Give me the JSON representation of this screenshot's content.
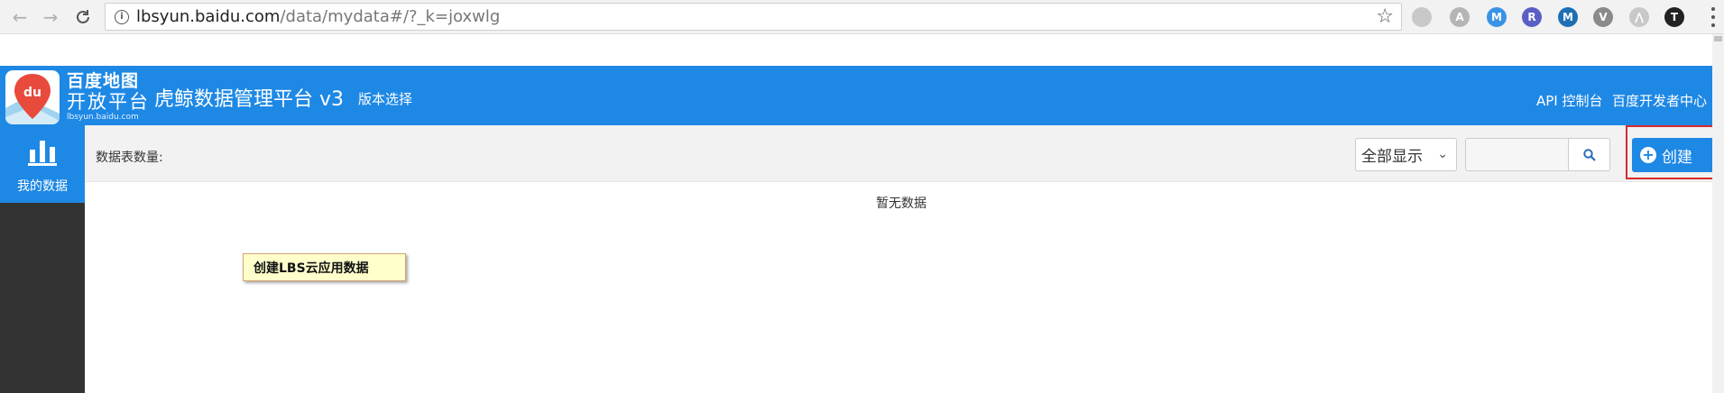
{
  "browser": {
    "url_host": "lbsyun.baidu.com",
    "url_path": "/data/mydata#/?_k=joxwlg",
    "extensions": [
      {
        "name": "extension-1",
        "letter": "",
        "color": "#c8c8c8"
      },
      {
        "name": "angular-extension",
        "letter": "A",
        "color": "#b5b5b5"
      },
      {
        "name": "m-extension",
        "letter": "M",
        "color": "#3a94e5"
      },
      {
        "name": "r-extension",
        "letter": "R",
        "color": "#5a5fc7"
      },
      {
        "name": "m-square-extension",
        "letter": "M",
        "color": "#1f6fb5"
      },
      {
        "name": "vue-extension",
        "letter": "V",
        "color": "#8a8a8a"
      },
      {
        "name": "tree-extension",
        "letter": "⋀",
        "color": "#c8c8c8"
      },
      {
        "name": "t-extension",
        "letter": "T",
        "color": "#222222"
      }
    ]
  },
  "header": {
    "logo_line1": "百度地图",
    "logo_line2": "开放平台",
    "logo_line3": "lbsyun.baidu.com",
    "logo_mark": "du",
    "title": "虎鲸数据管理平台 v3",
    "version_link": "版本选择",
    "api_console": "API 控制台",
    "dev_center": "百度开发者中心"
  },
  "sidebar": {
    "items": [
      {
        "label": "我的数据",
        "icon": "bar-chart-icon"
      }
    ]
  },
  "toolbar": {
    "count_label": "数据表数量:",
    "filter_value": "全部显示",
    "search_value": "",
    "create_label": "创建"
  },
  "main": {
    "empty_message": "暂无数据",
    "tooltip": "创建LBS云应用数据"
  },
  "colors": {
    "brand_blue": "#1e88e5",
    "sidebar_dark": "#333333",
    "highlight_red": "#d42b2b"
  }
}
